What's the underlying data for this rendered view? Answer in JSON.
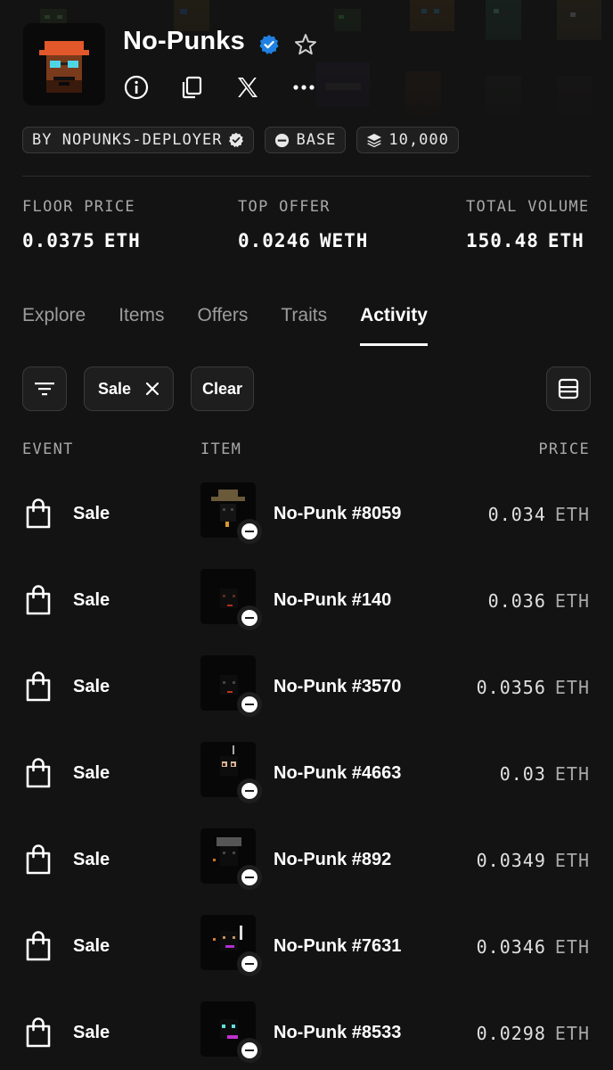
{
  "collection": {
    "name": "No-Punks",
    "verified": true,
    "header_icons": [
      "info-icon",
      "copy-icon",
      "x-logo-icon",
      "more-icon"
    ]
  },
  "chips": {
    "creator": "BY NOPUNKS-DEPLOYER",
    "chain": "BASE",
    "supply": "10,000"
  },
  "stats": [
    {
      "label": "FLOOR PRICE",
      "value": "0.0375",
      "currency": "ETH"
    },
    {
      "label": "TOP OFFER",
      "value": "0.0246",
      "currency": "WETH"
    },
    {
      "label": "TOTAL VOLUME",
      "value": "150.48",
      "currency": "ETH"
    }
  ],
  "tabs": [
    {
      "label": "Explore",
      "active": false
    },
    {
      "label": "Items",
      "active": false
    },
    {
      "label": "Offers",
      "active": false
    },
    {
      "label": "Traits",
      "active": false
    },
    {
      "label": "Activity",
      "active": true
    }
  ],
  "filters": {
    "active_filter": "Sale",
    "clear_label": "Clear"
  },
  "columns": {
    "event": "EVENT",
    "item": "ITEM",
    "price": "PRICE"
  },
  "activity": [
    {
      "event": "Sale",
      "item": "No-Punk #8059",
      "price": "0.034",
      "currency": "ETH"
    },
    {
      "event": "Sale",
      "item": "No-Punk #140",
      "price": "0.036",
      "currency": "ETH"
    },
    {
      "event": "Sale",
      "item": "No-Punk #3570",
      "price": "0.0356",
      "currency": "ETH"
    },
    {
      "event": "Sale",
      "item": "No-Punk #4663",
      "price": "0.03",
      "currency": "ETH"
    },
    {
      "event": "Sale",
      "item": "No-Punk #892",
      "price": "0.0349",
      "currency": "ETH"
    },
    {
      "event": "Sale",
      "item": "No-Punk #7631",
      "price": "0.0346",
      "currency": "ETH"
    },
    {
      "event": "Sale",
      "item": "No-Punk #8533",
      "price": "0.0298",
      "currency": "ETH"
    }
  ],
  "colors": {
    "background": "#131313",
    "verified_blue": "#2081e2",
    "chip_border": "#3a3a3a"
  }
}
